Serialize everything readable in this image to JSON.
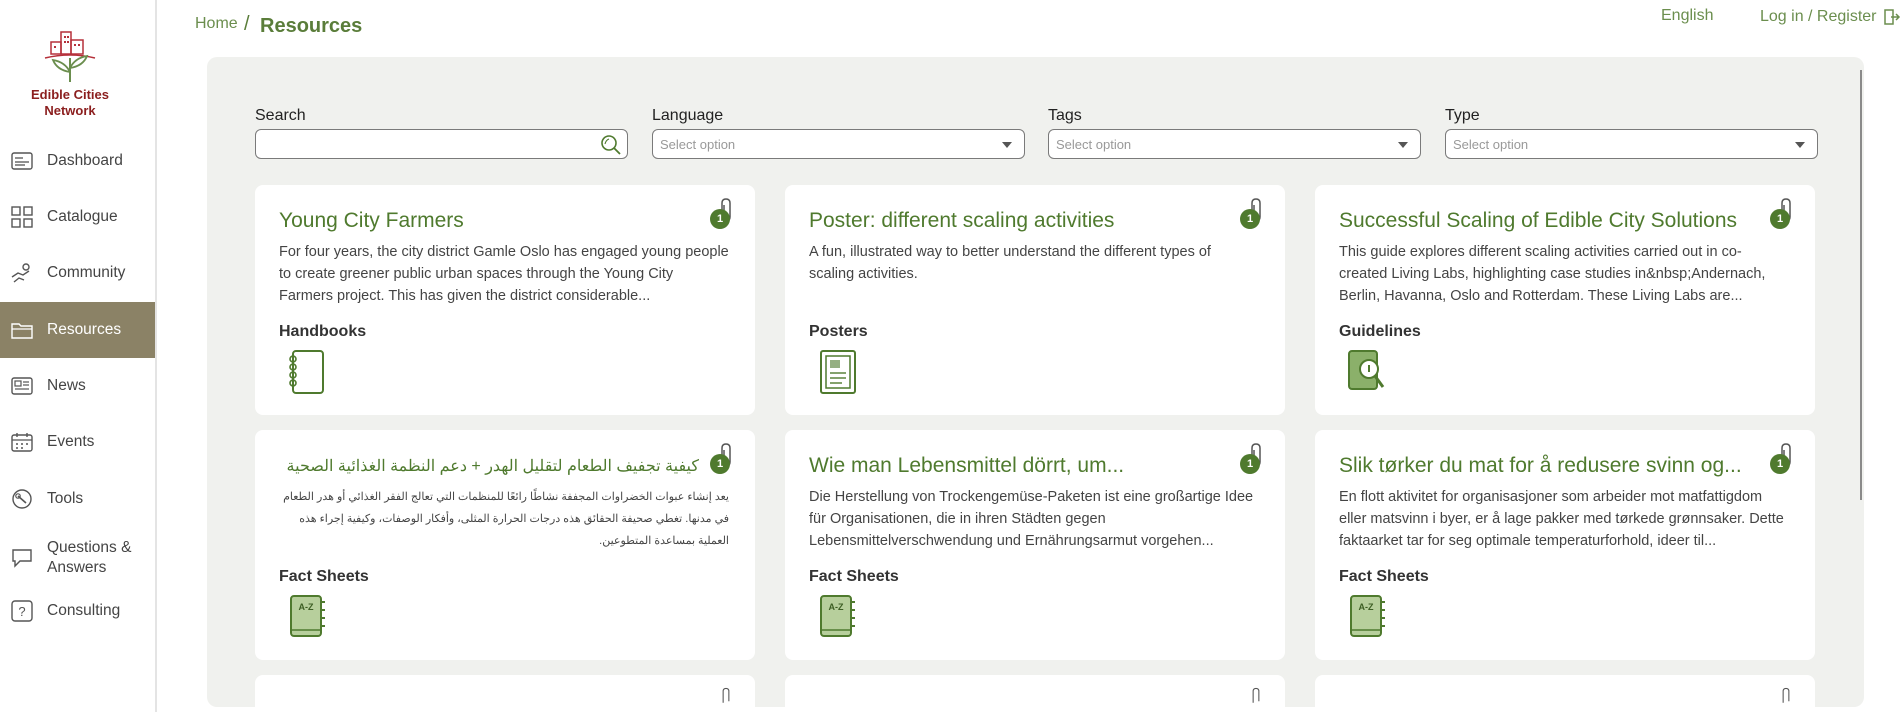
{
  "logo": {
    "line1": "Edible Cities",
    "line2": "Network"
  },
  "sidebar": {
    "items": [
      {
        "label": "Dashboard",
        "icon": "dashboard-icon"
      },
      {
        "label": "Catalogue",
        "icon": "catalogue-icon"
      },
      {
        "label": "Community",
        "icon": "community-icon"
      },
      {
        "label": "Resources",
        "icon": "resources-folder-icon",
        "active": true
      },
      {
        "label": "News",
        "icon": "news-icon"
      },
      {
        "label": "Events",
        "icon": "calendar-icon"
      },
      {
        "label": "Tools",
        "icon": "tools-icon"
      },
      {
        "label": "Questions & Answers",
        "icon": "chat-icon"
      },
      {
        "label": "Consulting",
        "icon": "question-icon"
      }
    ]
  },
  "header": {
    "breadcrumb_home": "Home",
    "breadcrumb_sep": "/",
    "breadcrumb_current": "Resources",
    "language": "English",
    "login": "Log in / Register"
  },
  "filters": {
    "search": {
      "label": "Search",
      "placeholder": ""
    },
    "language": {
      "label": "Language",
      "placeholder": "Select option"
    },
    "tags": {
      "label": "Tags",
      "placeholder": "Select option"
    },
    "type": {
      "label": "Type",
      "placeholder": "Select option"
    }
  },
  "cards": [
    {
      "title": "Young City Farmers",
      "description": "For four years, the city district Gamle Oslo has engaged young people to create greener public urban spaces through the Young City Farmers project. This has given the district considerable...",
      "type": "Handbooks",
      "type_icon": "notebook-icon",
      "attachments": "1"
    },
    {
      "title": "Poster: different scaling activities",
      "description": "A fun, illustrated way to better understand the different types of scaling activities.",
      "type": "Posters",
      "type_icon": "poster-icon",
      "attachments": "1"
    },
    {
      "title": "Successful Scaling of Edible City Solutions",
      "description": "This guide explores different scaling activities carried out in co-created Living Labs, highlighting case studies in&nbsp;Andernach, Berlin, Havanna, Oslo and Rotterdam. These Living Labs are...",
      "type": "Guidelines",
      "type_icon": "magnifier-book-icon",
      "attachments": "1"
    },
    {
      "title": "كيفية تجفيف الطعام لتقليل الهدر + دعم النظمة الغذائية الصحية",
      "description": "يعد إنشاء عبوات الخضراوات المجففة نشاطًا رائعًا للمنظمات التي تعالج الفقر الغذائي أو هدر الطعام في مدنها. تغطي صحيفة الحقائق هذه درجات الحرارة المثلى، وأفكار الوصفات، وكيفية إجراء هذه العملية بمساعدة المتطوعين.",
      "type": "Fact Sheets",
      "type_icon": "a-z-book-icon",
      "attachments": "1",
      "rtl": true
    },
    {
      "title": "Wie man Lebensmittel dörrt, um...",
      "description": "Die Herstellung von Trockengemüse-Paketen ist eine großartige Idee für Organisationen, die in ihren Städten gegen Lebensmittelverschwendung und Ernährungsarmut vorgehen...",
      "type": "Fact Sheets",
      "type_icon": "a-z-book-icon",
      "attachments": "1"
    },
    {
      "title": "Slik tørker du mat for å redusere svinn og...",
      "description": "En flott aktivitet for organisasjoner som arbeider mot matfattigdom eller matsvinn i byer, er å lage pakker med tørkede grønnsaker. Dette faktaarket tar for seg optimale temperaturforhold, ideer til...",
      "type": "Fact Sheets",
      "type_icon": "a-z-book-icon",
      "attachments": "1"
    }
  ],
  "colors": {
    "accent": "#4f7a2e",
    "sidebar_active": "#8b8266",
    "panel_bg": "#f0f1ee",
    "logo_red": "#8b1e1e"
  }
}
